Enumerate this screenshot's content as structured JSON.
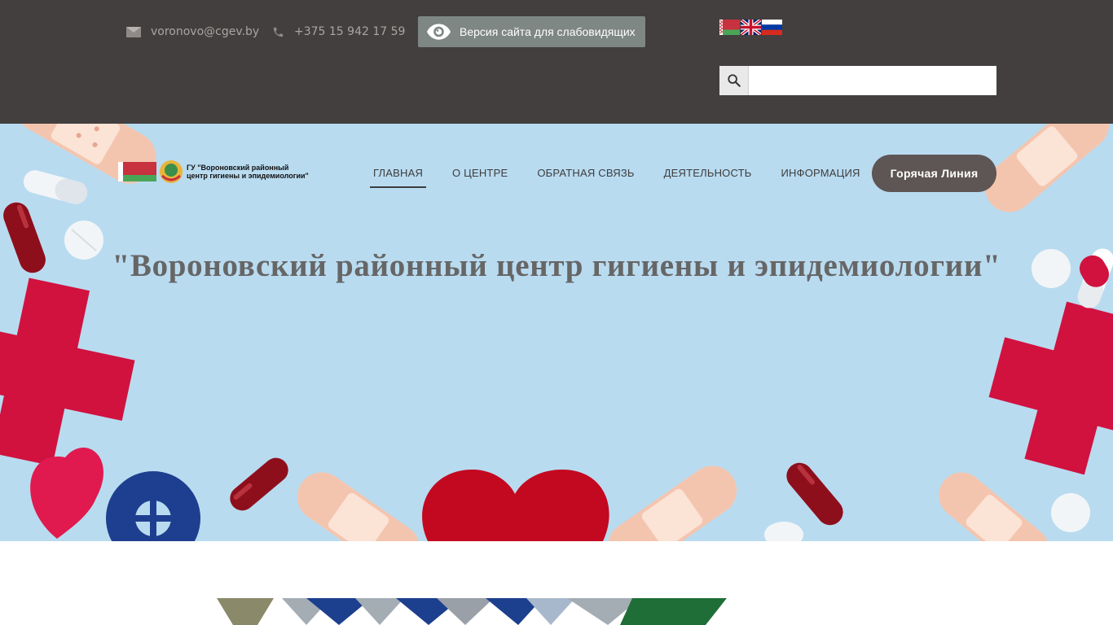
{
  "topbar": {
    "email": "voronovo@cgev.by",
    "phone": "+375 15 942 17 59",
    "vision_label": "Версия сайта для слабовидящих",
    "search_placeholder": ""
  },
  "icons": {
    "email": "envelope-icon",
    "phone": "phone-icon",
    "vision": "eye-icon",
    "search": "magnifier-icon"
  },
  "languages": [
    "be",
    "en",
    "ru"
  ],
  "logo": {
    "text": "ГУ \"Вороновский районный центр гигиены и эпидемиологии\""
  },
  "nav": {
    "items": [
      {
        "label": "ГЛАВНАЯ",
        "active": true
      },
      {
        "label": "О ЦЕНТРЕ",
        "active": false
      },
      {
        "label": "ОБРАТНАЯ СВЯЗЬ",
        "active": false
      },
      {
        "label": "ДЕЯТЕЛЬНОСТЬ",
        "active": false
      },
      {
        "label": "ИНФОРМАЦИЯ",
        "active": false
      }
    ],
    "hotline_label": "Горячая Линия"
  },
  "hero": {
    "title": "\"Вороновский районный центр гигиены и эпидемиологии\""
  },
  "colors": {
    "topbar_bg": "#433f3e",
    "hero_bg": "#b9dbf0",
    "button_bg": "#7e8784",
    "hotline_bg": "#5e5654",
    "accent_red": "#d1123f"
  }
}
